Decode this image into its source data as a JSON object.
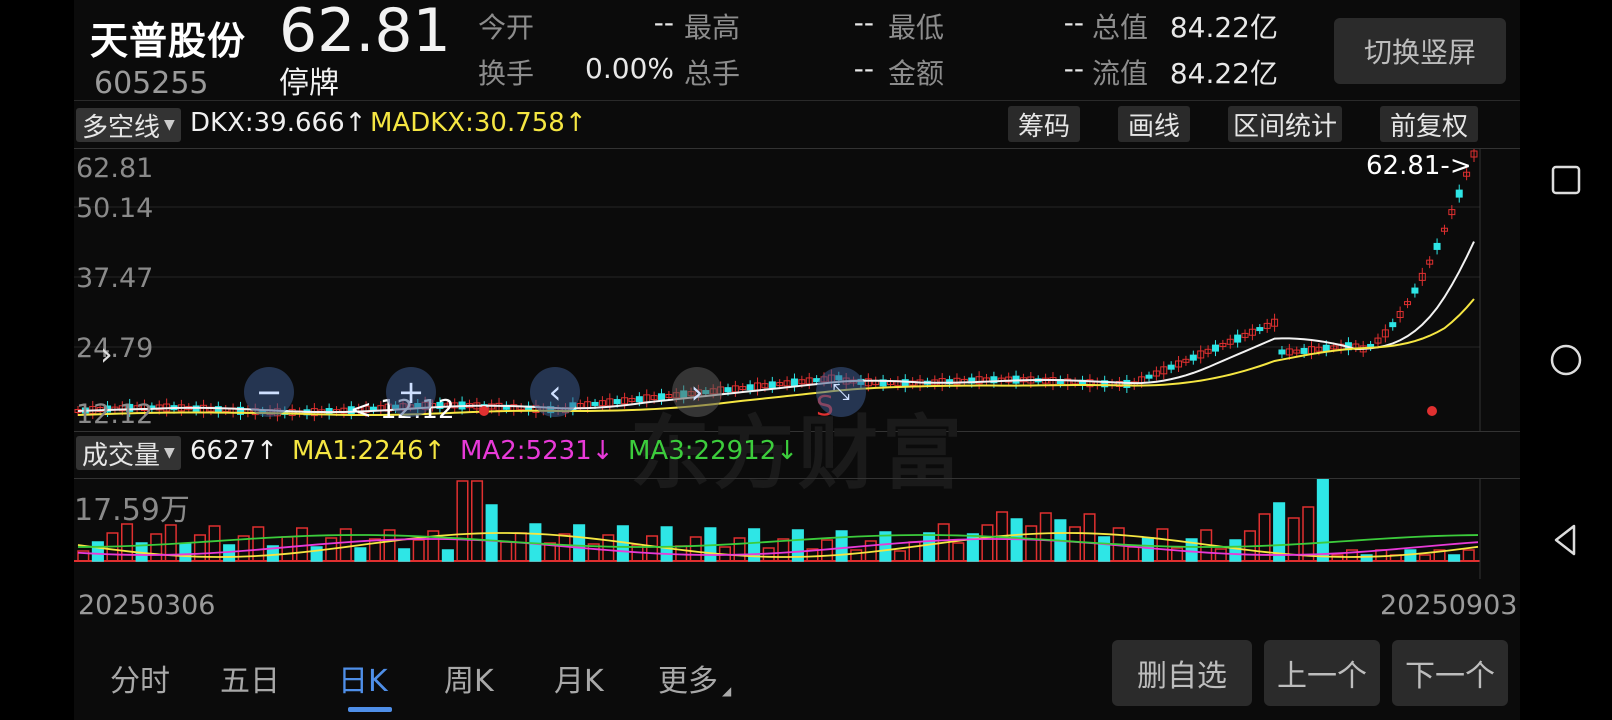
{
  "header": {
    "stock_name": "天普股份",
    "stock_code": "605255",
    "price": "62.81",
    "status": "停牌",
    "switch_button": "切换竖屏",
    "quotes": [
      {
        "label": "今开",
        "value": "--"
      },
      {
        "label": "最高",
        "value": "--"
      },
      {
        "label": "最低",
        "value": "--"
      },
      {
        "label": "总值",
        "value": "84.22亿"
      },
      {
        "label": "换手",
        "value": "0.00%"
      },
      {
        "label": "总手",
        "value": "--"
      },
      {
        "label": "金额",
        "value": "--"
      },
      {
        "label": "流值",
        "value": "84.22亿"
      }
    ]
  },
  "indicator": {
    "selector": "多空线",
    "dkx": "DKX:39.666↑",
    "madkx": "MADKX:30.758↑",
    "tools": [
      "筹码",
      "画线",
      "区间统计",
      "前复权"
    ]
  },
  "kline": {
    "y_ticks": [
      "62.81",
      "50.14",
      "37.47",
      "24.79",
      "12.12"
    ],
    "last_price_label": "62.81->",
    "low_label": "< 12.12",
    "sell_marker": "S",
    "watermark": "东方财富"
  },
  "volume": {
    "selector": "成交量",
    "vol": "6627↑",
    "ma1": "MA1:2246↑",
    "ma2": "MA2:5231↓",
    "ma3": "MA3:22912↓",
    "max_label": "17.59万"
  },
  "dates": {
    "start": "20250306",
    "end": "20250903"
  },
  "tabs": [
    "分时",
    "五日",
    "日K",
    "周K",
    "月K",
    "更多"
  ],
  "active_tab": "日K",
  "bottom_buttons": [
    "删自选",
    "上一个",
    "下一个"
  ],
  "colors": {
    "up": "#e03030",
    "down": "#2ee6e6",
    "ma1": "#f5e642",
    "ma2": "#e83ad8",
    "ma3": "#3ccc3c",
    "accent": "#4f8fe8"
  },
  "icons": [
    "square-icon",
    "circle-icon",
    "back-triangle-icon",
    "zoom-out-icon",
    "zoom-in-icon",
    "scroll-left-icon",
    "scroll-right-icon",
    "expand-arrow-icon"
  ]
}
